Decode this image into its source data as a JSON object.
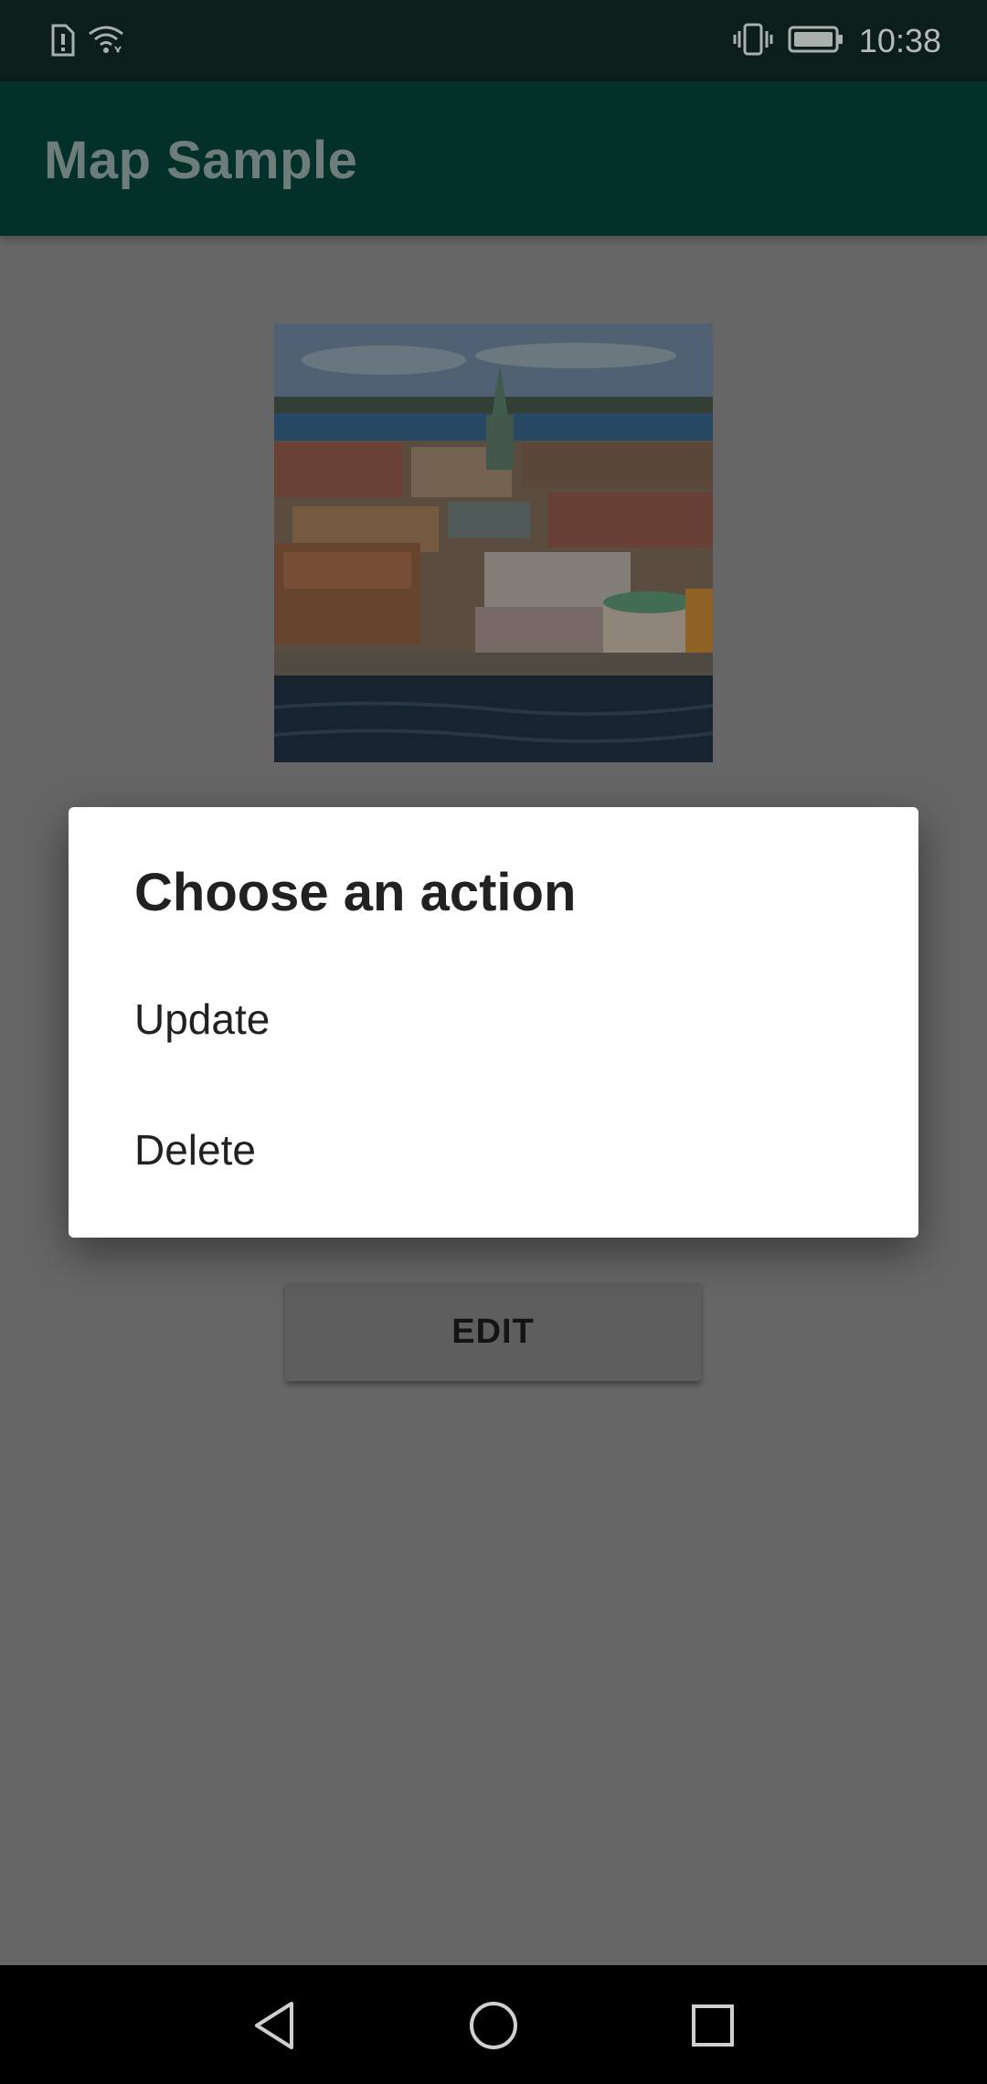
{
  "status_bar": {
    "time": "10:38",
    "icons": [
      "alert-sim-icon",
      "wifi-icon",
      "vibrate-icon",
      "battery-icon"
    ]
  },
  "app_bar": {
    "title": "Map Sample"
  },
  "main": {
    "image_icon": "city-photo",
    "edit_button_label": "EDIT"
  },
  "dialog": {
    "title": "Choose an action",
    "options": [
      {
        "label": "Update"
      },
      {
        "label": "Delete"
      }
    ]
  },
  "nav_bar": {
    "icons": [
      "back-icon",
      "home-icon",
      "recent-apps-icon"
    ]
  },
  "colors": {
    "scrim": "#666666",
    "app_bar": "#03312a",
    "status_bar": "#0b1e1a",
    "dialog_bg": "#ffffff",
    "text_primary": "#212121"
  }
}
